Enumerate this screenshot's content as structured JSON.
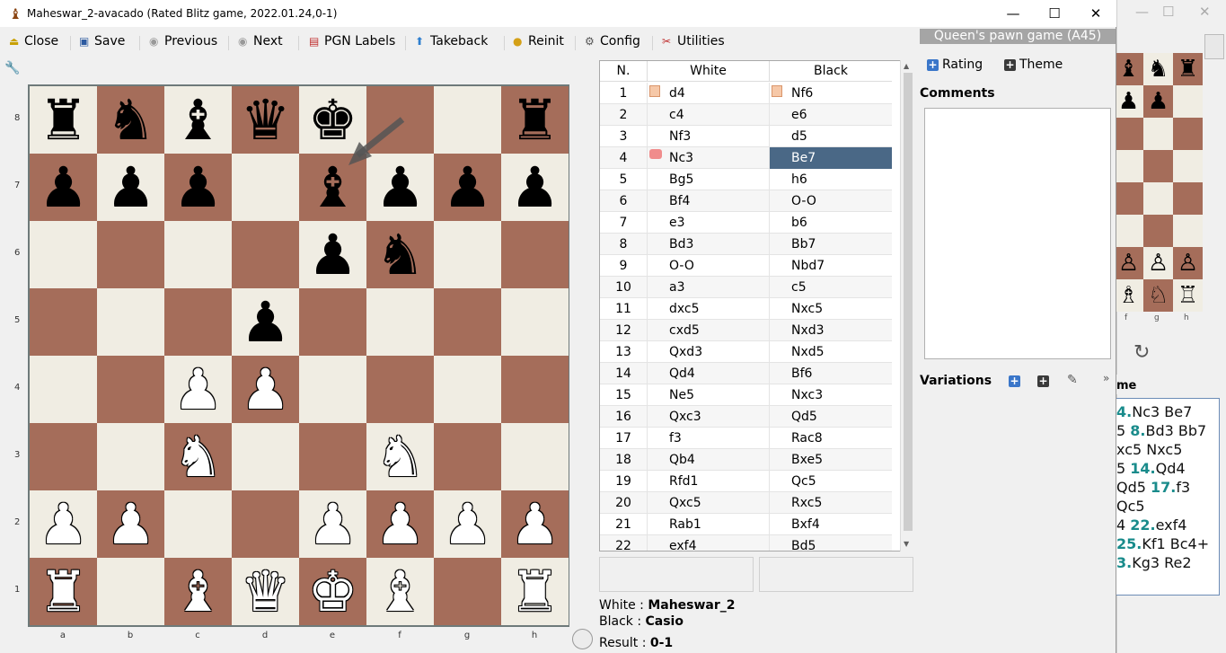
{
  "window": {
    "title": "Maheswar_2-avacado (Rated Blitz game, 2022.01.24,0-1)",
    "minimize": "—",
    "maximize": "☐",
    "close": "✕"
  },
  "toolbar": {
    "close": "Close",
    "save": "Save",
    "previous": "Previous",
    "next": "Next",
    "pgn_labels": "PGN Labels",
    "takeback": "Takeback",
    "reinit": "Reinit",
    "config": "Config",
    "utilities": "Utilities"
  },
  "board": {
    "ranks": [
      "8",
      "7",
      "6",
      "5",
      "4",
      "3",
      "2",
      "1"
    ],
    "files": [
      "a",
      "b",
      "c",
      "d",
      "e",
      "f",
      "g",
      "h"
    ],
    "position": [
      [
        "r",
        "n",
        "b",
        "q",
        "k",
        "",
        "",
        "r"
      ],
      [
        "p",
        "p",
        "p",
        "",
        "b",
        "p",
        "p",
        "p"
      ],
      [
        "",
        "",
        "",
        "",
        "p",
        "n",
        "",
        ""
      ],
      [
        "",
        "",
        "",
        "p",
        "",
        "",
        "",
        ""
      ],
      [
        "",
        "",
        "P",
        "P",
        "",
        "",
        "",
        ""
      ],
      [
        "",
        "",
        "N",
        "",
        "",
        "N",
        "",
        ""
      ],
      [
        "P",
        "P",
        "",
        "",
        "P",
        "P",
        "P",
        "P"
      ],
      [
        "R",
        "",
        "B",
        "Q",
        "K",
        "B",
        "",
        "R"
      ]
    ],
    "last_move_hint": "arrow pointing to e7"
  },
  "moves_table": {
    "headers": {
      "n": "N.",
      "white": "White",
      "black": "Black"
    },
    "rows": [
      {
        "n": "1",
        "white": "d4",
        "black": "Nf6"
      },
      {
        "n": "2",
        "white": "c4",
        "black": "e6"
      },
      {
        "n": "3",
        "white": "Nf3",
        "black": "d5"
      },
      {
        "n": "4",
        "white": "Nc3",
        "black": "Be7"
      },
      {
        "n": "5",
        "white": "Bg5",
        "black": "h6"
      },
      {
        "n": "6",
        "white": "Bf4",
        "black": "O-O"
      },
      {
        "n": "7",
        "white": "e3",
        "black": "b6"
      },
      {
        "n": "8",
        "white": "Bd3",
        "black": "Bb7"
      },
      {
        "n": "9",
        "white": "O-O",
        "black": "Nbd7"
      },
      {
        "n": "10",
        "white": "a3",
        "black": "c5"
      },
      {
        "n": "11",
        "white": "dxc5",
        "black": "Nxc5"
      },
      {
        "n": "12",
        "white": "cxd5",
        "black": "Nxd3"
      },
      {
        "n": "13",
        "white": "Qxd3",
        "black": "Nxd5"
      },
      {
        "n": "14",
        "white": "Qd4",
        "black": "Bf6"
      },
      {
        "n": "15",
        "white": "Ne5",
        "black": "Nxc3"
      },
      {
        "n": "16",
        "white": "Qxc3",
        "black": "Qd5"
      },
      {
        "n": "17",
        "white": "f3",
        "black": "Rac8"
      },
      {
        "n": "18",
        "white": "Qb4",
        "black": "Bxe5"
      },
      {
        "n": "19",
        "white": "Rfd1",
        "black": "Qc5"
      },
      {
        "n": "20",
        "white": "Qxc5",
        "black": "Rxc5"
      },
      {
        "n": "21",
        "white": "Rab1",
        "black": "Bxf4"
      },
      {
        "n": "22",
        "white": "exf4",
        "black": "Bd5"
      }
    ],
    "selected_row": 3
  },
  "players": {
    "white_label": "White : ",
    "white": "Maheswar_2",
    "black_label": "Black : ",
    "black": "Casio",
    "result_label": "Result : ",
    "result": "0-1"
  },
  "right_panel": {
    "opening": "Queen's pawn game (A45)",
    "rating": "Rating",
    "theme": "Theme",
    "comments": "Comments",
    "variations": "Variations"
  },
  "background_window": {
    "header": "me",
    "lines": [
      {
        "num": "4.",
        "text": "Nc3 Be7"
      },
      {
        "num": "8.",
        "text": "Bd3 Bb7",
        "pre": "5 "
      },
      {
        "num": "",
        "text": "xc5 Nxc5"
      },
      {
        "num": "14.",
        "text": "Qd4",
        "pre": "5 "
      },
      {
        "num": "17.",
        "text": "f3",
        "pre": "Qd5 "
      },
      {
        "num": "",
        "text": "Qc5"
      },
      {
        "num": "22.",
        "text": "exf4",
        "pre": "4 "
      },
      {
        "num": "25.",
        "text": "Kf1 Bc4+"
      },
      {
        "num": "3.",
        "text": "Kg3 Re2"
      }
    ],
    "files": [
      "f",
      "g",
      "h"
    ]
  },
  "colors": {
    "light_square": "#f0ede3",
    "dark_square": "#a56d5a",
    "selected": "#4a6886",
    "move_number": "#198b8b"
  }
}
